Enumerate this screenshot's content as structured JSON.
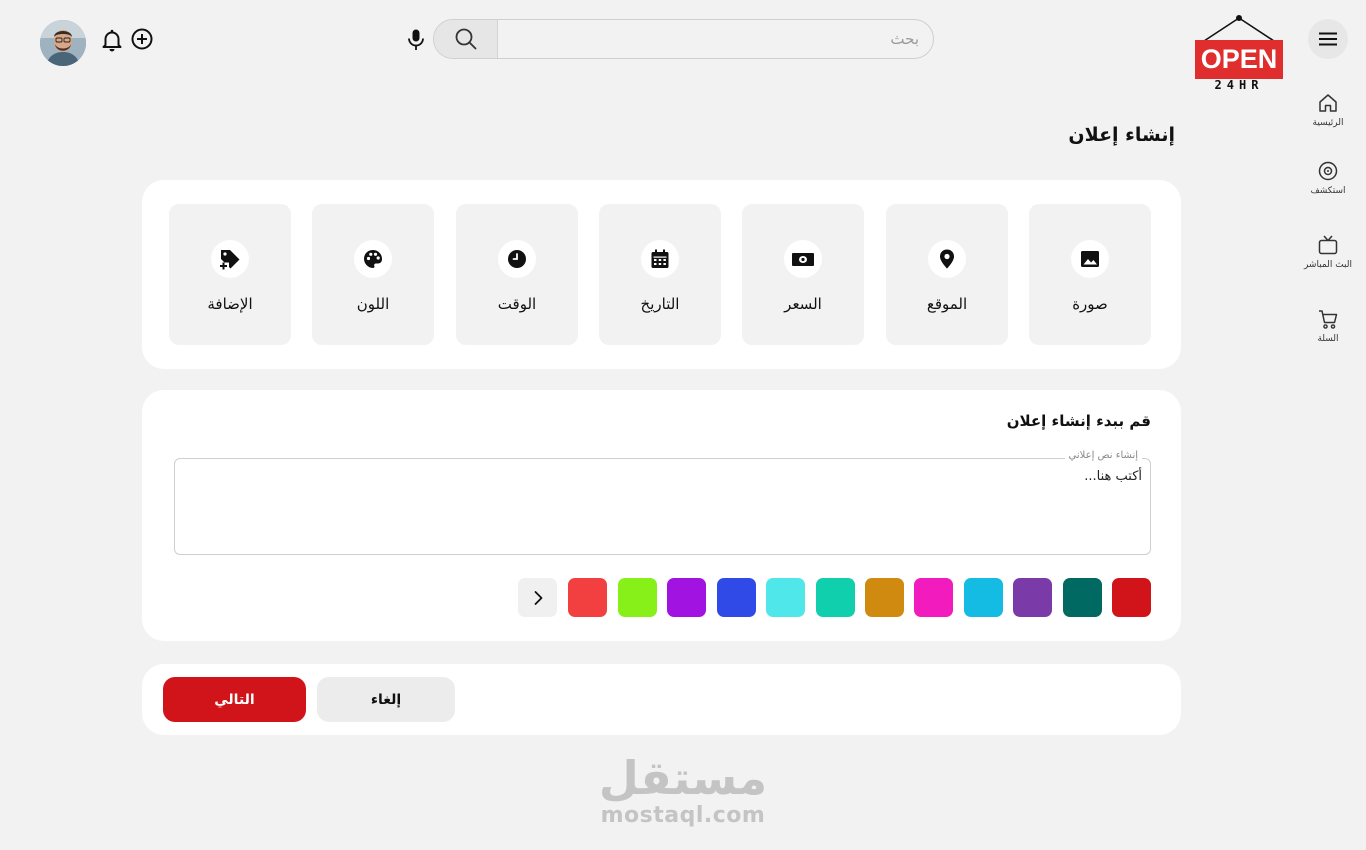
{
  "header": {
    "logo": {
      "sign_text": "OPEN",
      "sub_text": "24HR"
    },
    "search": {
      "placeholder": "بحث"
    },
    "icons": [
      "menu-icon",
      "search-icon",
      "microphone-icon",
      "bell-icon",
      "add-circle-icon",
      "avatar"
    ]
  },
  "sidebar": {
    "items": [
      {
        "label": "الرئيسية",
        "icon": "home-icon"
      },
      {
        "label": "استكشف",
        "icon": "explore-disc-icon"
      },
      {
        "label": "البث المباشر",
        "icon": "tv-icon"
      },
      {
        "label": "السلة",
        "icon": "cart-icon"
      }
    ]
  },
  "main": {
    "title": "إنشاء إعلان",
    "tools": [
      {
        "label": "صورة",
        "icon": "image-icon"
      },
      {
        "label": "الموقع",
        "icon": "location-pin-icon"
      },
      {
        "label": "السعر",
        "icon": "money-icon"
      },
      {
        "label": "التاريخ",
        "icon": "calendar-icon"
      },
      {
        "label": "الوقت",
        "icon": "clock-icon"
      },
      {
        "label": "اللون",
        "icon": "palette-icon"
      },
      {
        "label": "الإضافة",
        "icon": "tag-add-icon"
      }
    ],
    "compose": {
      "title": "قم ببدء إنشاء إعلان",
      "field_label": "إنشاء نص إعلاني",
      "field_value": "أكتب هنا..."
    },
    "swatches": [
      "#d0141a",
      "#006a62",
      "#7a3aa8",
      "#14bbe3",
      "#f21bbd",
      "#d18a10",
      "#10cfad",
      "#4fe7e9",
      "#304ae8",
      "#a013e0",
      "#86f018",
      "#f23f3f"
    ],
    "actions": {
      "next_label": "التالي",
      "cancel_label": "إلغاء"
    }
  },
  "watermark": {
    "arabic": "مستقل",
    "latin": "mostaql.com"
  },
  "colors": {
    "accent": "#d0141a",
    "logo_red": "#e02d2d",
    "background": "#f2f2f2"
  }
}
